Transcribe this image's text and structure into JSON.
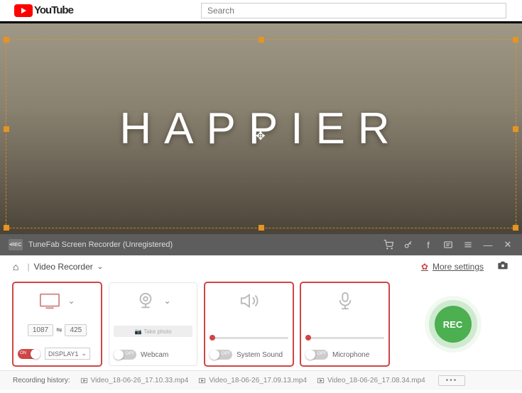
{
  "youtube": {
    "brand": "YouTube",
    "search_placeholder": "Search"
  },
  "video": {
    "overlay_title": "HAPPIER"
  },
  "titlebar": {
    "app_title": "TuneFab Screen Recorder (Unregistered)",
    "rec_badge": "•REC"
  },
  "subheader": {
    "breadcrumb": "Video Recorder",
    "more_settings": "More settings"
  },
  "panel_screen": {
    "width": "1087",
    "height": "425",
    "toggle_label": "ON",
    "display": "DISPLAY1"
  },
  "panel_webcam": {
    "take_photo": "Take photo",
    "toggle_label": "OFF",
    "label": "Webcam"
  },
  "panel_sound": {
    "toggle_label": "OFF",
    "label": "System Sound"
  },
  "panel_mic": {
    "toggle_label": "OFF",
    "label": "Microphone"
  },
  "rec_button": {
    "label": "REC"
  },
  "footer": {
    "history_label": "Recording history:",
    "items": [
      "Video_18-06-26_17.10.33.mp4",
      "Video_18-06-26_17.09.13.mp4",
      "Video_18-06-26_17.08.34.mp4"
    ]
  }
}
